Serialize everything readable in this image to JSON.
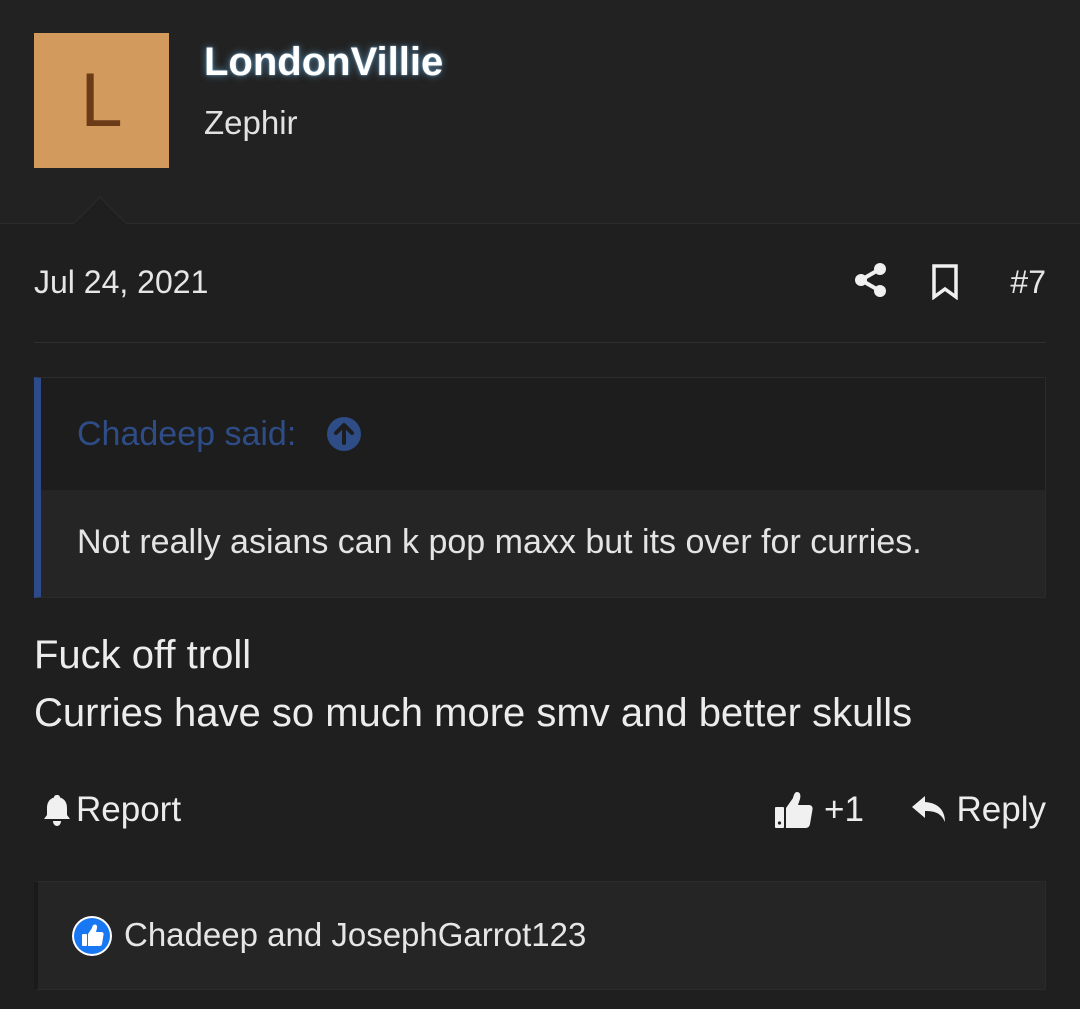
{
  "user": {
    "avatar_letter": "L",
    "name": "LondonVillie",
    "title": "Zephir"
  },
  "post": {
    "date": "Jul 24, 2021",
    "number": "#7",
    "quote": {
      "author_label": "Chadeep said:",
      "text": "Not really asians can k pop maxx but its over for curries."
    },
    "body_lines": [
      "Fuck off troll",
      "Curries have so much more smv and better skulls"
    ]
  },
  "actions": {
    "report_label": "Report",
    "like_count": "+1",
    "reply_label": "Reply"
  },
  "reactions": {
    "users_text": "Chadeep and JosephGarrot123"
  },
  "icons": {
    "share": "share-icon",
    "bookmark": "bookmark-icon",
    "quote_up": "arrow-up-circle-icon",
    "report": "bell-icon",
    "like": "thumbs-up-icon",
    "reply": "reply-icon",
    "reaction": "like-reaction-icon"
  },
  "colors": {
    "background": "#1f1f1f",
    "avatar_bg": "#d39a5d",
    "avatar_text": "#6b3b17",
    "quote_accent": "#2d4a8a",
    "quote_author": "#2e4c86",
    "reaction_blue": "#1877f2"
  }
}
